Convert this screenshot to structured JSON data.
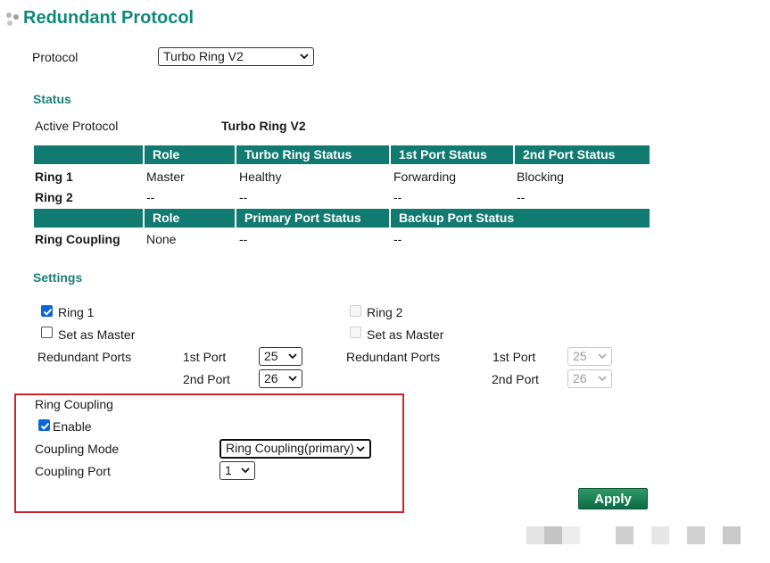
{
  "page_title": "Redundant Protocol",
  "protocol": {
    "label": "Protocol",
    "value": "Turbo Ring V2"
  },
  "status": {
    "heading": "Status",
    "active_protocol_label": "Active Protocol",
    "active_protocol_value": "Turbo Ring V2",
    "ring_table": {
      "headers": [
        "Role",
        "Turbo Ring Status",
        "1st Port Status",
        "2nd Port Status"
      ],
      "rows": [
        {
          "name": "Ring 1",
          "cells": [
            "Master",
            "Healthy",
            "Forwarding",
            "Blocking"
          ]
        },
        {
          "name": "Ring 2",
          "cells": [
            "--",
            "--",
            "--",
            "--"
          ]
        }
      ]
    },
    "coupling_table": {
      "headers": [
        "Role",
        "Primary Port Status",
        "Backup Port Status"
      ],
      "rows": [
        {
          "name": "Ring Coupling",
          "cells": [
            "None",
            "--",
            "--"
          ]
        }
      ]
    }
  },
  "settings": {
    "heading": "Settings",
    "ring1": {
      "label": "Ring 1",
      "checked": true,
      "set_as_master_label": "Set as Master",
      "set_as_master_checked": false,
      "redundant_ports_label": "Redundant Ports",
      "first_port_label": "1st Port",
      "first_port_value": "25",
      "second_port_label": "2nd Port",
      "second_port_value": "26"
    },
    "ring2": {
      "label": "Ring 2",
      "checked": false,
      "set_as_master_label": "Set as Master",
      "set_as_master_checked": false,
      "redundant_ports_label": "Redundant Ports",
      "first_port_label": "1st Port",
      "first_port_value": "25",
      "second_port_label": "2nd Port",
      "second_port_value": "26"
    },
    "ring_coupling": {
      "label": "Ring Coupling",
      "enable_label": "Enable",
      "enable_checked": true,
      "mode_label": "Coupling Mode",
      "mode_value": "Ring Coupling(primary)",
      "port_label": "Coupling Port",
      "port_value": "1"
    }
  },
  "apply_label": "Apply",
  "colors": {
    "title": "#0f8a7a",
    "section": "#1d7f78",
    "table_header": "#117a71",
    "highlight_box": "#d6212a",
    "apply": "#157a52"
  }
}
